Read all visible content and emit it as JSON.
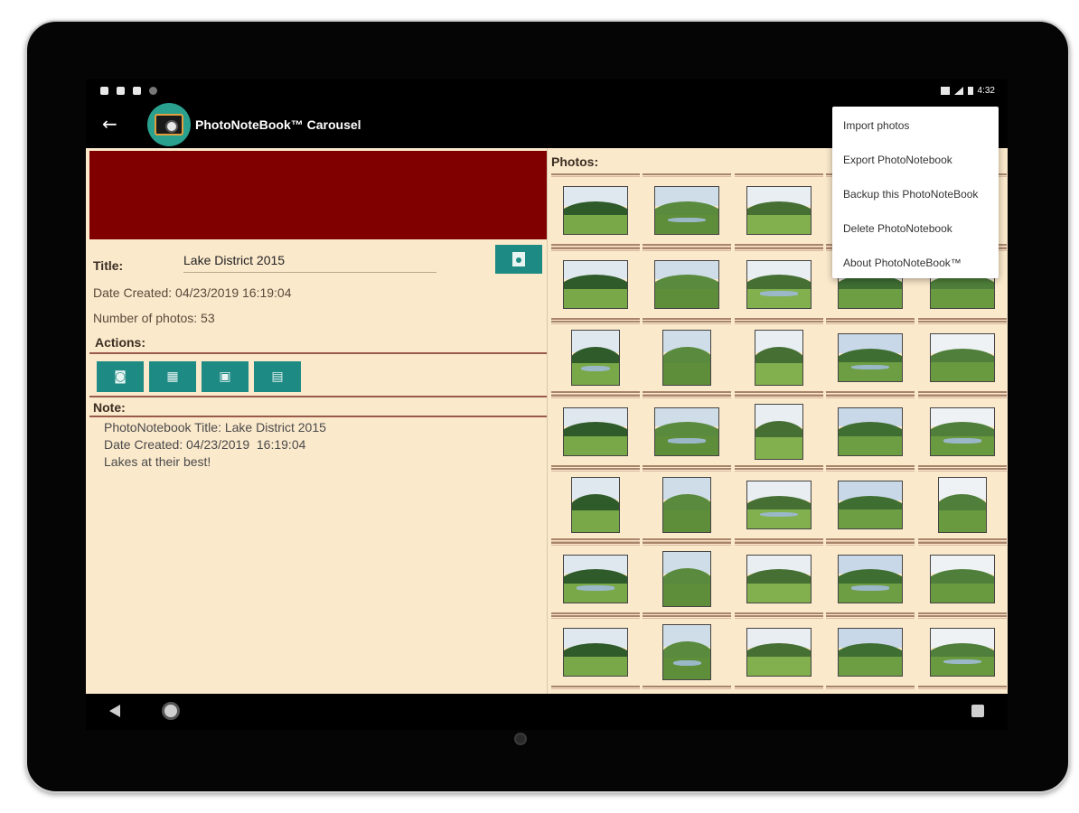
{
  "app": {
    "title": "PhotoNoteBook™ Carousel",
    "back_icon": "arrow-left-icon",
    "logo_icon": "camera-logo-icon"
  },
  "status_bar": {
    "time": "4:32",
    "left_icons": [
      "settings-icon",
      "notification-icon",
      "sd-card-icon",
      "dot-icon"
    ],
    "right_icons": [
      "wifi-icon",
      "signal-icon",
      "battery-icon"
    ]
  },
  "details": {
    "title_label": "Title:",
    "title_value": "Lake District 2015",
    "date_created": "Date Created: 04/23/2019  16:19:04",
    "number_of_photos": "Number of photos: 53",
    "actions_label": "Actions:",
    "note_label": "Note:",
    "note_text": "PhotoNotebook Title: Lake District 2015\nDate Created: 04/23/2019  16:19:04\nLakes at their best!",
    "banner_color": "#800000",
    "accent_color": "#1e8a84",
    "background_color": "#fbe9cc"
  },
  "action_buttons": [
    {
      "name": "camera-button",
      "icon": "camera-icon"
    },
    {
      "name": "gallery-button",
      "icon": "gallery-icon"
    },
    {
      "name": "portrait-button",
      "icon": "portrait-icon"
    },
    {
      "name": "grid-button",
      "icon": "grid-icon"
    }
  ],
  "photos": {
    "label": "Photos:",
    "columns": 5,
    "rows": 7
  },
  "overflow_menu": {
    "items": [
      "Import photos",
      "Export PhotoNotebook",
      "Backup this PhotoNoteBook",
      "Delete PhotoNotebook",
      "About PhotoNoteBook™"
    ]
  },
  "nav_bar": {
    "back_icon": "nav-back-icon",
    "home_icon": "nav-home-icon",
    "recents_icon": "nav-recents-icon"
  }
}
